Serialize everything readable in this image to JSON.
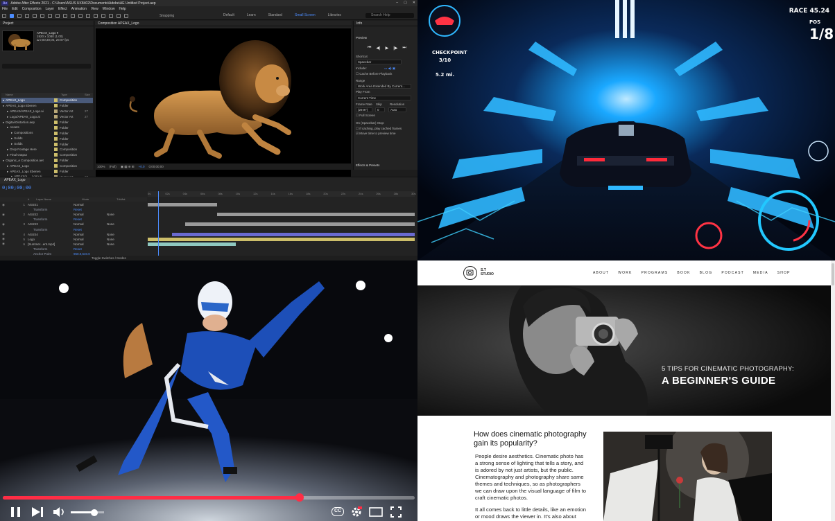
{
  "after_effects": {
    "title": "Adobe After Effects 2021 - C:\\Users\\ASUS UX8402\\Documents\\Adobe\\AE Untitled Project.aep",
    "badge": "Ae",
    "menu": [
      "File",
      "Edit",
      "Composition",
      "Layer",
      "Effect",
      "Animation",
      "View",
      "Window",
      "Help"
    ],
    "snapping": "Snapping",
    "workspaces": [
      "Default",
      "Learn",
      "Standard",
      "Small Screen",
      "Libraries"
    ],
    "active_workspace": "Small Screen",
    "search_placeholder": "Search Help",
    "project_tab": "Project",
    "project_name": "APEAX_Logo ▾",
    "project_info": [
      "1920 x 1080 (1.00)",
      "Δ 0;00;30;00, 29.97 fps"
    ],
    "project_cols": [
      "Name",
      "Type",
      "Size"
    ],
    "project_items": [
      {
        "name": "APEAX_Logo",
        "type": "Composition",
        "color": "#cdbe6a",
        "sel": true,
        "indent": 0
      },
      {
        "name": "APEAX_Logo Ebenen",
        "type": "Folder",
        "color": "#cdbe6a",
        "indent": 0
      },
      {
        "name": "APEAX/APEAX_Logo.ai",
        "type": "Vector Art",
        "size": "27",
        "color": "#b8a878",
        "indent": 1
      },
      {
        "name": "Logo/APEAX_Logo.ai",
        "type": "Vector Art",
        "size": "27",
        "color": "#b8a878",
        "indent": 1
      },
      {
        "name": "Digital-Distortion.aep",
        "type": "Folder",
        "color": "#cdbe6a",
        "indent": 0
      },
      {
        "name": "Assets",
        "type": "Folder",
        "color": "#cdbe6a",
        "indent": 1
      },
      {
        "name": "Compositions",
        "type": "Folder",
        "color": "#cdbe6a",
        "indent": 2
      },
      {
        "name": "Solids",
        "type": "Folder",
        "color": "#cdbe6a",
        "indent": 2
      },
      {
        "name": "Solids",
        "type": "Folder",
        "color": "#cdbe6a",
        "indent": 2
      },
      {
        "name": "Drop Footage Here",
        "type": "Composition",
        "color": "#cdbe6a",
        "indent": 1
      },
      {
        "name": "Final Output",
        "type": "Composition",
        "color": "#cdbe6a",
        "indent": 1
      },
      {
        "name": "Organic_e Composition.aet",
        "type": "Folder",
        "color": "#cdbe6a",
        "indent": 0
      },
      {
        "name": "APEAX_Logo",
        "type": "Composition",
        "color": "#cdbe6a",
        "indent": 1
      },
      {
        "name": "APEAX_Logo Ebenen",
        "type": "Folder",
        "color": "#cdbe6a",
        "indent": 1
      },
      {
        "name": "APEAX/A..._Logo.ai",
        "type": "Vector Art",
        "size": "27",
        "color": "#b8a878",
        "indent": 2
      },
      {
        "name": "Logo/APEAX_Logo.ai",
        "type": "Vector Art",
        "size": "27",
        "color": "#b8a878",
        "indent": 2
      },
      {
        "name": "Summer...Event.mp4",
        "type": "Importe...",
        "size": "53",
        "color": "#8aa0b8",
        "indent": 1
      }
    ],
    "comp_tab": "Composition APEAX_Logo",
    "viewer_bar": [
      "100%",
      "(Full)",
      "+0.0",
      "0;00;00;00"
    ],
    "info_tab": "Info",
    "preview_tab": "Preview",
    "preview_controls": [
      "⏮",
      "◀|",
      "▶",
      "|▶",
      "⏭"
    ],
    "shortcut_label": "Shortcut",
    "shortcut_value": "Spacebar",
    "include_label": "Include:",
    "cache_label": "Cache Before Playback",
    "range_label": "Range",
    "range_value": "Work Area Extended By Current...",
    "playfrom_label": "Play From",
    "playfrom_value": "Current Time",
    "framerate_cols": [
      "Frame Rate",
      "Skip",
      "Resolution"
    ],
    "framerate_vals": [
      "(29.97)",
      "0",
      "Auto"
    ],
    "fullscreen_label": "Full Screen",
    "stop_label": "On (Spacebar) Stop:",
    "stop_opt1": "If caching, play cached frames",
    "stop_opt2": "Move time to preview time",
    "effects_tab": "Effects & Presets",
    "timeline_tab": "APEAX_Logo",
    "timecode": "0;00;00;00",
    "ruler_ticks": [
      "0s",
      "02s",
      "04s",
      "06s",
      "08s",
      "10s",
      "12s",
      "14s",
      "16s",
      "18s",
      "20s",
      "22s",
      "24s",
      "26s",
      "28s",
      "30s"
    ],
    "layer_cols": [
      "#",
      "Layer Name",
      "Mode",
      "TrkMat"
    ],
    "layers": [
      {
        "num": "1",
        "name": "ASUS1",
        "mode": "Normal",
        "mat": "",
        "bar_from": 0,
        "bar_to": 0.26,
        "color": "#9a9a9a"
      },
      {
        "num": "",
        "name": "Transform",
        "mode": "Reset",
        "mat": "",
        "sub": true
      },
      {
        "num": "2",
        "name": "ASUS2",
        "mode": "Normal",
        "mat": "None",
        "bar_from": 0.26,
        "bar_to": 1,
        "color": "#9a9a9a"
      },
      {
        "num": "",
        "name": "Transform",
        "mode": "Reset",
        "mat": "",
        "sub": true
      },
      {
        "num": "3",
        "name": "ASUS3",
        "mode": "Normal",
        "mat": "None",
        "bar_from": 0.14,
        "bar_to": 1,
        "color": "#9a9a9a"
      },
      {
        "num": "",
        "name": "Transform",
        "mode": "Reset",
        "mat": "",
        "sub": true
      },
      {
        "num": "4",
        "name": "ASUS4",
        "mode": "Normal",
        "mat": "None",
        "bar_from": 0.09,
        "bar_to": 1,
        "color": "#6a6ad0"
      },
      {
        "num": "5",
        "name": "Logo",
        "mode": "Normal",
        "mat": "None",
        "bar_from": 0,
        "bar_to": 1,
        "color": "#cdbe6a"
      },
      {
        "num": "6",
        "name": "[Summer...ent.mp4]",
        "mode": "Normal",
        "mat": "None",
        "bar_from": 0,
        "bar_to": 0.33,
        "color": "#8fc8c0"
      },
      {
        "num": "",
        "name": "Transform",
        "mode": "Reset",
        "mat": "",
        "sub": true
      },
      {
        "num": "",
        "name": "Anchor Point",
        "mode": "960.0,540.0",
        "mat": "",
        "sub": true
      }
    ],
    "toggle_label": "Toggle Switches / Modes"
  },
  "game": {
    "race_time": "RACE 45.24",
    "pos_label": "POS",
    "pos_value": "1/8",
    "checkpoint_label": "CHECKPOINT",
    "checkpoint_value": "3/10",
    "distance": "5.2 mi.",
    "colors": {
      "neon": "#1fb6ff",
      "speedo": "#22c8ff",
      "alert": "#ff3344"
    }
  },
  "video": {
    "progress": 0.72,
    "progress_color": "#ff2d45",
    "volume": 0.7,
    "controls": {
      "play": "pause-icon",
      "next": "next-icon",
      "volume": "volume-icon",
      "cc": "CC",
      "settings": "settings-icon",
      "miniplayer": "miniplayer-icon",
      "fullscreen": "fullscreen-icon"
    }
  },
  "website": {
    "brand": [
      "S.T",
      "STUDIO"
    ],
    "nav": [
      "ABOUT",
      "WORK",
      "PROGRAMS",
      "BOOK",
      "BLOG",
      "PODCAST",
      "MEDIA",
      "SHOP"
    ],
    "hero_subtitle": "5 TIPS FOR CINEMATIC PHOTOGRAPHY:",
    "hero_title": "A BEGINNER'S GUIDE",
    "article_heading": "How does cinematic photography gain its popularity?",
    "article_para1": "People desire aesthetics. Cinematic photo has a strong sense of lighting that tells a story, and is adored by not just artists, but the public. Cinematography and photography share same themes and techniques, so as photographers we can draw upon the visual language of film to craft cinematic photos.",
    "article_para2": "It all comes back to little details, like an emotion or mood draws the viewer in. It's also about"
  }
}
